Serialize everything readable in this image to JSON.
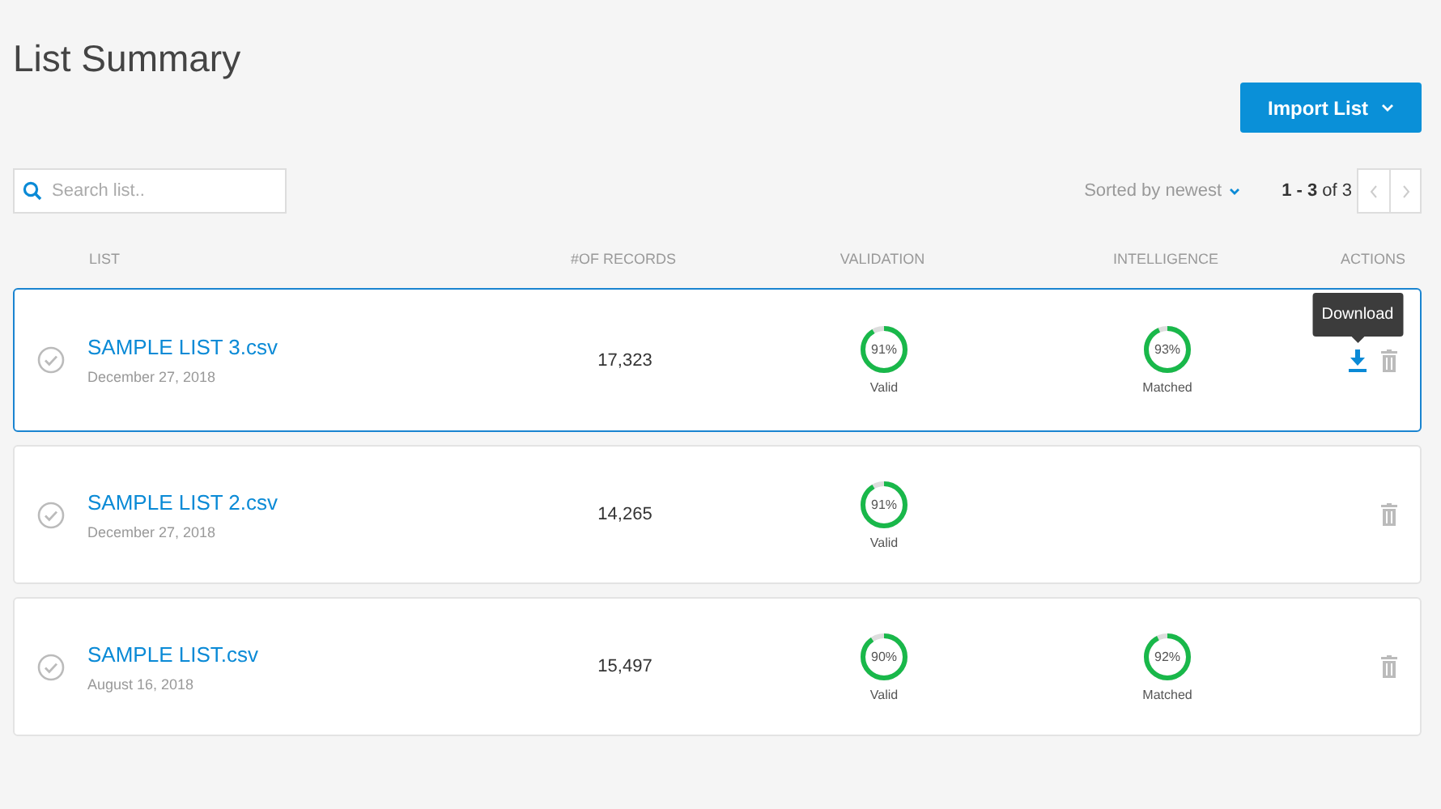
{
  "title": "List Summary",
  "import_button": {
    "label": "Import List"
  },
  "search": {
    "placeholder": "Search list.."
  },
  "sort": {
    "label": "Sorted by newest"
  },
  "pagination": {
    "range": "1 - 3",
    "total": "of 3"
  },
  "columns": [
    "LIST",
    "#OF RECORDS",
    "VALIDATION",
    "INTELLIGENCE",
    "ACTIONS"
  ],
  "rows": [
    {
      "name": "SAMPLE LIST 3.csv",
      "date": "December 27, 2018",
      "records": "17,323",
      "selected": true,
      "validation": {
        "level": 0.91,
        "reading": "91%",
        "caption": "Valid"
      },
      "intelligence": {
        "level": 0.93,
        "reading": "93%",
        "caption": "Matched"
      },
      "actions": [
        {
          "kind": "download",
          "tooltip": "Download"
        },
        {
          "kind": "delete"
        }
      ]
    },
    {
      "name": "SAMPLE LIST 2.csv",
      "date": "December 27, 2018",
      "records": "14,265",
      "selected": false,
      "validation": {
        "level": 0.91,
        "reading": "91%",
        "caption": "Valid"
      },
      "actions": [
        {
          "kind": "delete"
        }
      ]
    },
    {
      "name": "SAMPLE LIST.csv",
      "date": "August 16, 2018",
      "records": "15,497",
      "selected": false,
      "validation": {
        "level": 0.9,
        "reading": "90%",
        "caption": "Valid"
      },
      "intelligence": {
        "level": 0.92,
        "reading": "92%",
        "caption": "Matched"
      },
      "actions": [
        {
          "kind": "delete"
        }
      ]
    }
  ]
}
